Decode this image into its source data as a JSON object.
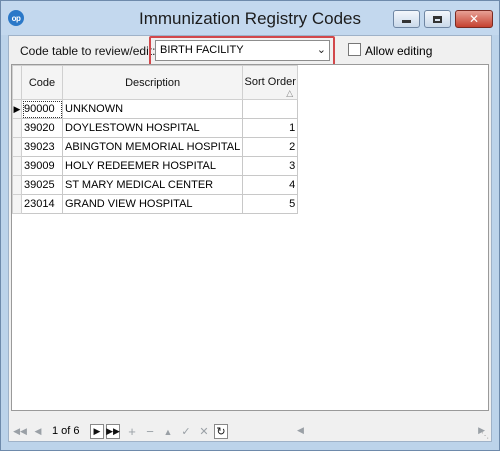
{
  "window": {
    "title": "Immunization Registry Codes",
    "app_icon_text": "op",
    "close_glyph": "✕"
  },
  "toolbar": {
    "code_table_label": "Code table to review/edit:",
    "selected_table": "BIRTH FACILITY",
    "allow_editing_label": "Allow editing",
    "allow_editing_checked": false
  },
  "grid": {
    "columns": [
      "Code",
      "Description",
      "Sort Order"
    ],
    "rows": [
      {
        "code": "90000",
        "description": "UNKNOWN",
        "sort_order": ""
      },
      {
        "code": "39020",
        "description": "DOYLESTOWN HOSPITAL",
        "sort_order": "1"
      },
      {
        "code": "39023",
        "description": "ABINGTON MEMORIAL HOSPITAL",
        "sort_order": "2"
      },
      {
        "code": "39009",
        "description": "HOLY REDEEMER HOSPITAL",
        "sort_order": "3"
      },
      {
        "code": "39025",
        "description": "ST MARY MEDICAL CENTER",
        "sort_order": "4"
      },
      {
        "code": "23014",
        "description": "GRAND VIEW HOSPITAL",
        "sort_order": "5"
      }
    ]
  },
  "navigator": {
    "position_text": "1 of 6"
  },
  "colors": {
    "highlight_border": "#d2484b",
    "title_bar": "#c3d8ee"
  }
}
